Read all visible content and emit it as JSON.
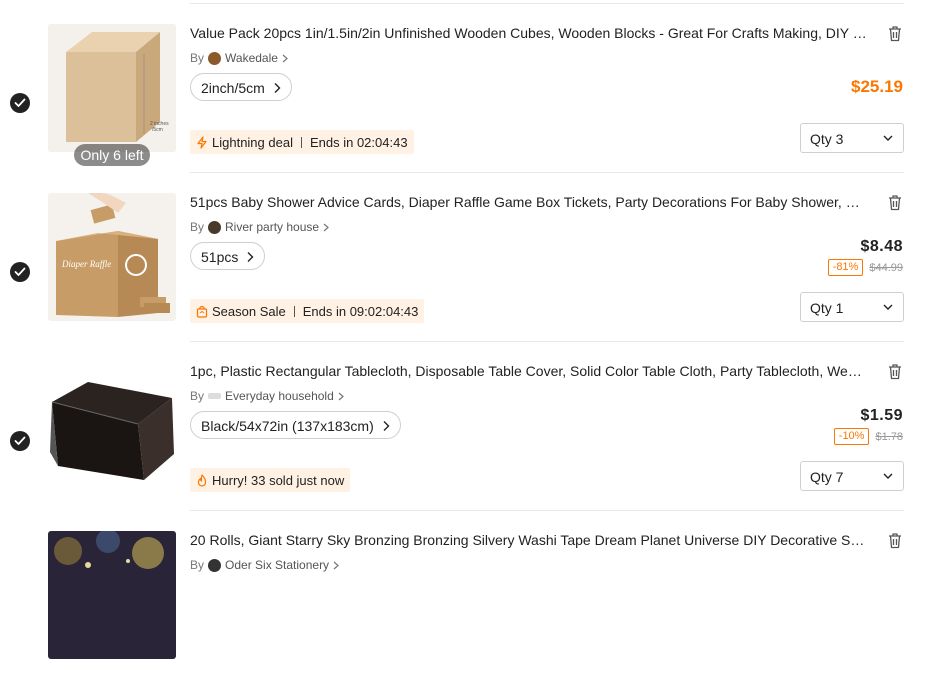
{
  "cart": {
    "by_label": "By",
    "qty_label": "Qty",
    "items": [
      {
        "title": "Value Pack 20pcs 1in/1.5in/2in Unfinished Wooden Cubes, Wooden Blocks - Great For Crafts Making, DIY Cr...",
        "store": "Wakedale",
        "variant": "2inch/5cm",
        "price": "$25.19",
        "tag_label": "Lightning deal",
        "tag_ends": "Ends in 02:04:43",
        "tag_icon": "lightning-icon",
        "qty": "3",
        "stock_badge": "Only 6 left",
        "image_text_1": "2 inches",
        "image_text_2": "/5cm"
      },
      {
        "title": "51pcs Baby Shower Advice Cards, Diaper Raffle Game Box Tickets, Party Decorations For Baby Shower, Birthd...",
        "store": "River party house",
        "variant": "51pcs",
        "price": "$8.48",
        "discount": "-81%",
        "original_price": "$44.99",
        "tag_label": "Season Sale",
        "tag_ends": "Ends in 09:02:04:43",
        "tag_icon": "shopping-bag-icon",
        "qty": "1",
        "image_text_1": "Diaper Raffle"
      },
      {
        "title": "1pc, Plastic Rectangular Tablecloth, Disposable Table Cover, Solid Color Table Cloth, Party Tablecloth, Weddin...",
        "store": "Everyday household",
        "variant": "Black/54x72in (137x183cm)",
        "price": "$1.59",
        "discount": "-10%",
        "original_price": "$1.78",
        "tag_label": "Hurry! 33 sold just now",
        "tag_icon": "flame-icon",
        "qty": "7"
      },
      {
        "title": "20 Rolls, Giant Starry Sky Bronzing Bronzing Silvery Washi Tape Dream Planet Universe DIY Decorative Sticker...",
        "store": "Oder Six Stationery"
      }
    ]
  },
  "colors": {
    "accent": "#fb7701",
    "tag_bg": "#fff1e3",
    "check_bg": "#222222"
  }
}
